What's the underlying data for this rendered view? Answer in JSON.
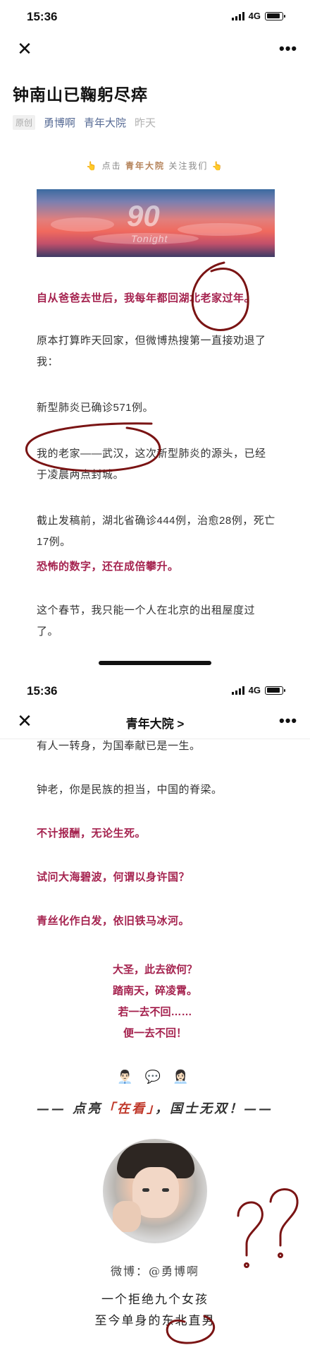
{
  "screen1": {
    "status": {
      "time": "15:36",
      "network": "4G"
    },
    "nav": {
      "close_icon": "close-icon",
      "more_icon": "more-icon"
    },
    "article": {
      "title": "钟南山已鞠躬尽瘁",
      "badge": "原创",
      "author": "勇博啊",
      "account": "青年大院",
      "date": "昨天"
    },
    "follow": {
      "prefix": "点击",
      "account": "青年大院",
      "suffix": "关注我们"
    },
    "banner": {
      "logo": "90",
      "subtitle": "Tonight"
    },
    "paragraphs": [
      "自从爸爸去世后，我每年都回湖北老家过年。",
      "原本打算昨天回家，但微博热搜第一直接劝退了我：",
      "新型肺炎已确诊571例。",
      "我的老家——武汉，这次新型肺炎的源头，已经于凌晨两点封城。",
      "截止发稿前，湖北省确诊444例，治愈28例，死亡17例。",
      "恐怖的数字，还在成倍攀升。",
      "这个春节，我只能一个人在北京的出租屋度过了。"
    ]
  },
  "screen2": {
    "status": {
      "time": "15:36",
      "network": "4G"
    },
    "nav": {
      "title": "青年大院 >"
    },
    "paragraphs": [
      "有人一转身，为国奉献已是一生。",
      "钟老，你是民族的担当，中国的脊梁。",
      "不计报酬，无论生死。",
      "试问大海碧波，何谓以身许国？",
      "青丝化作白发，依旧铁马冰河。"
    ],
    "poem": [
      "大圣，此去欲何？",
      "踏南天，碎凌霄。",
      "若一去不回……",
      "便一去不回！"
    ],
    "emoji": "👨🏻‍💼 💬 👩🏻‍💼",
    "slogan": {
      "prefix": "—— 点亮",
      "highlight": "「在看」",
      "suffix": "，国士无双！——"
    },
    "weibo": "微博：@勇博啊",
    "bio": [
      "一个拒绝九个女孩",
      "至今单身的东北直男"
    ],
    "handwriting": "??"
  },
  "colors": {
    "accent_red": "#a5234f",
    "link_blue": "#576b95",
    "ink_red": "#7a1414"
  }
}
